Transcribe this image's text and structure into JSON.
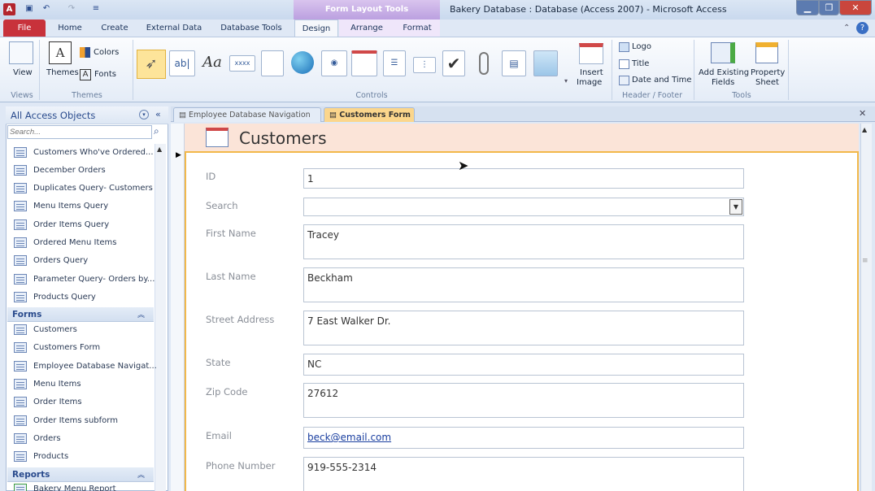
{
  "window": {
    "app_icon": "A",
    "title": "Bakery Database : Database (Access 2007)  -  Microsoft Access",
    "contextual_tab_group": "Form Layout Tools"
  },
  "tabs": {
    "file": "File",
    "home": "Home",
    "create": "Create",
    "external": "External Data",
    "dbtools": "Database Tools",
    "design": "Design",
    "arrange": "Arrange",
    "format": "Format"
  },
  "ribbon": {
    "views": {
      "view": "View",
      "group": "Views"
    },
    "themes": {
      "themes": "Themes",
      "colors": "Colors",
      "fonts": "Fonts",
      "group": "Themes"
    },
    "controls": {
      "group": "Controls",
      "textbox": "ab|",
      "label": "Aa",
      "button": "xxxx"
    },
    "insert_image": {
      "line1": "Insert",
      "line2": "Image"
    },
    "header_footer": {
      "logo": "Logo",
      "title": "Title",
      "datetime": "Date and Time",
      "group": "Header / Footer"
    },
    "tools": {
      "add_fields_1": "Add Existing",
      "add_fields_2": "Fields",
      "prop_1": "Property",
      "prop_2": "Sheet",
      "group": "Tools"
    }
  },
  "nav": {
    "header": "All Access Objects",
    "search_placeholder": "Search...",
    "queries": [
      "Customers Who've Ordered...",
      "December Orders",
      "Duplicates Query- Customers",
      "Menu Items Query",
      "Order Items Query",
      "Ordered Menu Items",
      "Orders Query",
      "Parameter Query- Orders by...",
      "Products Query"
    ],
    "forms_header": "Forms",
    "forms": [
      "Customers",
      "Customers Form",
      "Employee Database Navigat...",
      "Menu Items",
      "Order Items",
      "Order Items  subform",
      "Orders",
      "Products"
    ],
    "reports_header": "Reports",
    "reports": [
      "Bakery Menu Report"
    ]
  },
  "doc_tabs": {
    "tab1": "Employee Database Navigation",
    "tab2": "Customers Form"
  },
  "form": {
    "title": "Customers",
    "fields": [
      {
        "label": "ID",
        "value": "1"
      },
      {
        "label": "Search",
        "value": ""
      },
      {
        "label": "First Name",
        "value": "Tracey"
      },
      {
        "label": "Last Name",
        "value": "Beckham"
      },
      {
        "label": "Street Address",
        "value": "7 East Walker Dr."
      },
      {
        "label": "State",
        "value": "NC"
      },
      {
        "label": "Zip Code",
        "value": "27612"
      },
      {
        "label": "Email",
        "value": "beck@email.com"
      },
      {
        "label": "Phone Number",
        "value": "919-555-2314"
      }
    ]
  },
  "colors": {
    "file_tab": "#c8323b",
    "contextual": "#bba0e0",
    "form_header": "#fbe4d8",
    "form_border": "#f2b84a"
  }
}
